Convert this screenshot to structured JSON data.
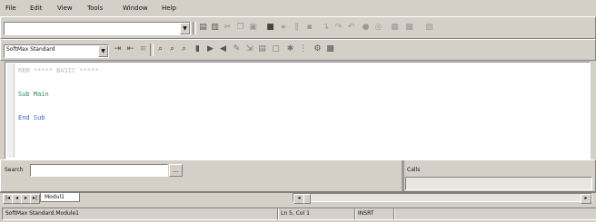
{
  "menu": [
    "File",
    "Edit",
    "View",
    "Tools",
    "Window",
    "Help"
  ],
  "toolbar1": {
    "combo_value": "",
    "icons": [
      "open-icon",
      "save-icon",
      "cut-icon",
      "copy-icon",
      "paste-icon",
      "print-icon",
      "run-icon",
      "pause-icon",
      "stop-icon",
      "step-icon",
      "step-over-icon",
      "step-out-icon",
      "breakpoint-icon"
    ]
  },
  "toolbar2": {
    "combo_value": "SoftMax Standard",
    "icons": [
      "indent-icon",
      "outdent-icon",
      "comment-icon",
      "uncomment-icon",
      "bookmark-icon",
      "next-bookmark-icon",
      "prev-bookmark-icon",
      "find-icon",
      "replace-icon",
      "goto-icon",
      "macro-icon",
      "settings-icon",
      "help-icon"
    ]
  },
  "editor": {
    "lines": [
      {
        "text": "REM  *****  BASIC  *****",
        "color": "#b8b8b8"
      },
      {
        "text": "Sub Main",
        "color": "#2e8b57"
      },
      {
        "text": "End Sub",
        "color": "#3a5fcd"
      }
    ]
  },
  "search": {
    "label": "Search",
    "value": "",
    "go_label": "..."
  },
  "calls": {
    "label": "Calls"
  },
  "tabs": {
    "nav": [
      "|◂",
      "◂",
      "▸",
      "▸|"
    ],
    "active": "Modul1"
  },
  "status": {
    "module": "SoftMax Standard.Module1",
    "position": "Ln 5, Col 1",
    "mode": "INSRT"
  }
}
